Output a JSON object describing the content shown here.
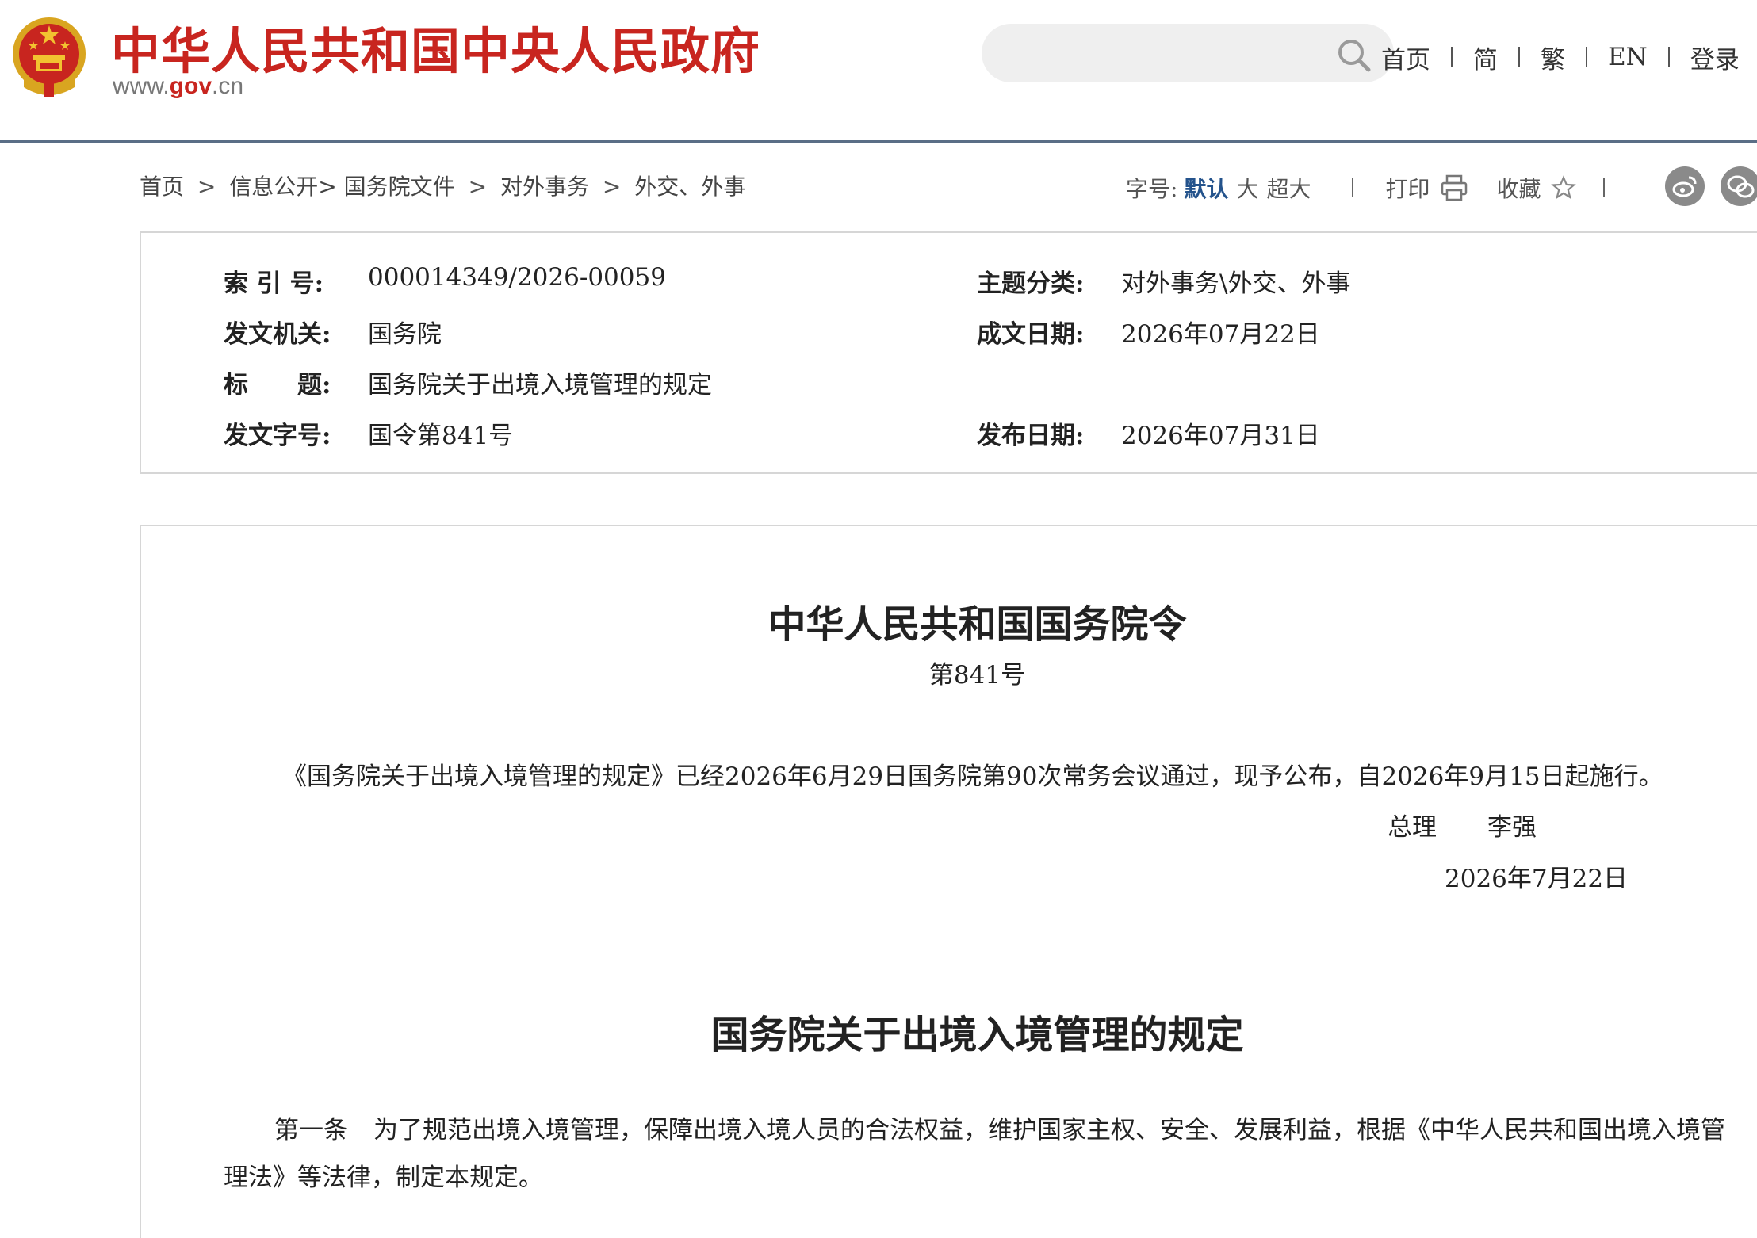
{
  "header": {
    "site_title": "中华人民共和国中央人民政府",
    "url_prefix": "www.",
    "url_gov": "gov",
    "url_suffix": ".cn",
    "search_placeholder": "",
    "nav": [
      "首页",
      "简",
      "繁",
      "EN",
      "登录"
    ]
  },
  "breadcrumb": {
    "items": [
      "首页",
      "信息公开",
      "国务院文件",
      "对外事务",
      "外交、外事"
    ],
    "separators": [
      " > ",
      "> ",
      " > ",
      " > "
    ]
  },
  "tools": {
    "font_size_label": "字号:",
    "font_default": "默认",
    "font_large": "大",
    "font_xlarge": "超大",
    "print_label": "打印",
    "favorite_label": "收藏"
  },
  "info": {
    "index_label": "索 引 号:",
    "index_value": "000014349/2026-00059",
    "topic_label": "主题分类:",
    "topic_value": "对外事务\\外交、外事",
    "issuer_label": "发文机关:",
    "issuer_value": "国务院",
    "written_date_label": "成文日期:",
    "written_date_value": "2026年07月22日",
    "title_label": "标　　题:",
    "title_value": "国务院关于出境入境管理的规定",
    "doc_no_label": "发文字号:",
    "doc_no_value": "国令第841号",
    "publish_date_label": "发布日期:",
    "publish_date_value": "2026年07月31日"
  },
  "document": {
    "decree_title": "中华人民共和国国务院令",
    "decree_number": "第841号",
    "decree_text": "《国务院关于出境入境管理的规定》已经2026年6月29日国务院第90次常务会议通过，现予公布，自2026年9月15日起施行。",
    "signer_title": "总理",
    "signer_name": "李强",
    "sign_date": "2026年7月22日",
    "regulation_title": "国务院关于出境入境管理的规定",
    "article_1_no": "第一条",
    "article_1_text": "为了规范出境入境管理，保障出境入境人员的合法权益，维护国家主权、安全、发展利益，根据《中华人民共和国出境入境管理法》等法律，制定本规定。"
  },
  "colors": {
    "brand_red": "#c8251f",
    "header_rule": "#5a6e86",
    "accent_blue": "#24538c"
  }
}
